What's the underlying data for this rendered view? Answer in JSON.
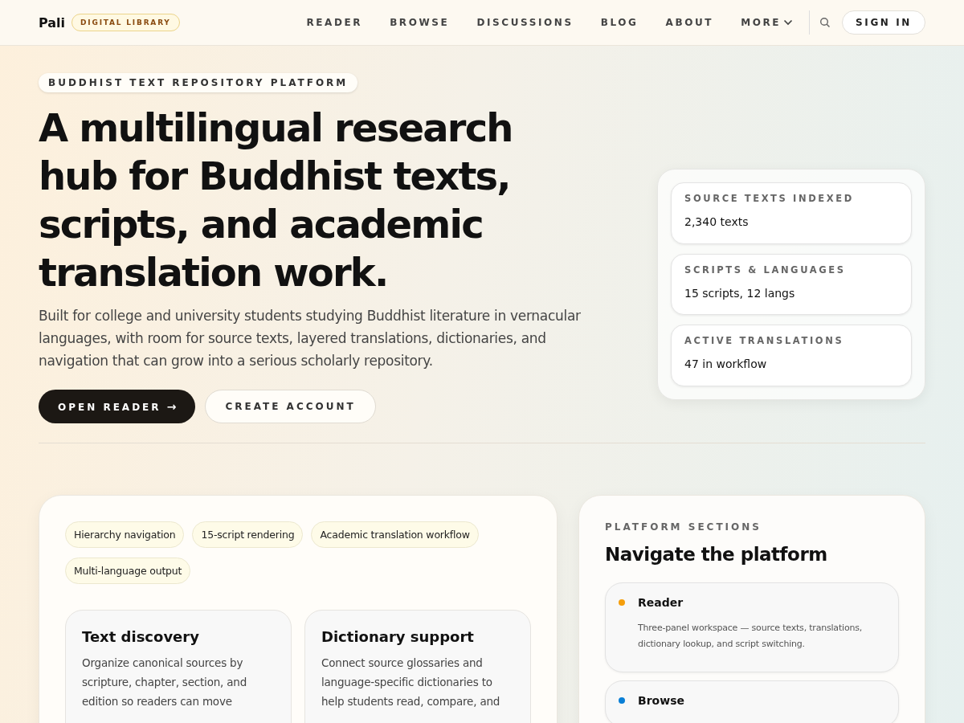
{
  "header": {
    "brand": "Pali",
    "badge": "DIGITAL LIBRARY",
    "nav": [
      {
        "label": "READER",
        "has_menu": false
      },
      {
        "label": "BROWSE",
        "has_menu": false
      },
      {
        "label": "DISCUSSIONS",
        "has_menu": false
      },
      {
        "label": "BLOG",
        "has_menu": false
      },
      {
        "label": "ABOUT",
        "has_menu": false
      },
      {
        "label": "MORE",
        "has_menu": true
      }
    ],
    "sign_in": "SIGN IN"
  },
  "hero": {
    "eyebrow": "BUDDHIST TEXT REPOSITORY PLATFORM",
    "title": "A multilingual research hub for Buddhist texts, scripts, and academic translation work.",
    "lead": "Built for college and university students studying Buddhist literature in vernacular languages, with room for source texts, layered translations, dictionaries, and navigation that can grow into a serious scholarly repository.",
    "buttons": [
      {
        "label": "OPEN READER",
        "kind": "primary",
        "arrow": "→"
      },
      {
        "label": "CREATE ACCOUNT",
        "kind": "secondary"
      }
    ],
    "stats": [
      {
        "label": "SOURCE TEXTS INDEXED",
        "value": "2,340 texts"
      },
      {
        "label": "SCRIPTS & LANGUAGES",
        "value": "15 scripts, 12 langs"
      },
      {
        "label": "ACTIVE TRANSLATIONS",
        "value": "47 in workflow"
      }
    ]
  },
  "features": {
    "tags": [
      "Hierarchy navigation",
      "15-script rendering",
      "Academic translation workflow",
      "Multi-language output"
    ],
    "cards": [
      {
        "title": "Text discovery",
        "body": "Organize canonical sources by scripture, chapter, section, and edition so readers can move"
      },
      {
        "title": "Dictionary support",
        "body": "Connect source glossaries and language-specific dictionaries to help students read, compare, and"
      }
    ]
  },
  "sections": {
    "eyebrow": "PLATFORM SECTIONS",
    "title": "Navigate the platform",
    "items": [
      {
        "name": "Reader",
        "color": "#f59e0b",
        "description": "Three-panel workspace — source texts, translations, dictionary lookup, and script switching."
      },
      {
        "name": "Browse",
        "color": "#0a7fd6"
      }
    ]
  }
}
